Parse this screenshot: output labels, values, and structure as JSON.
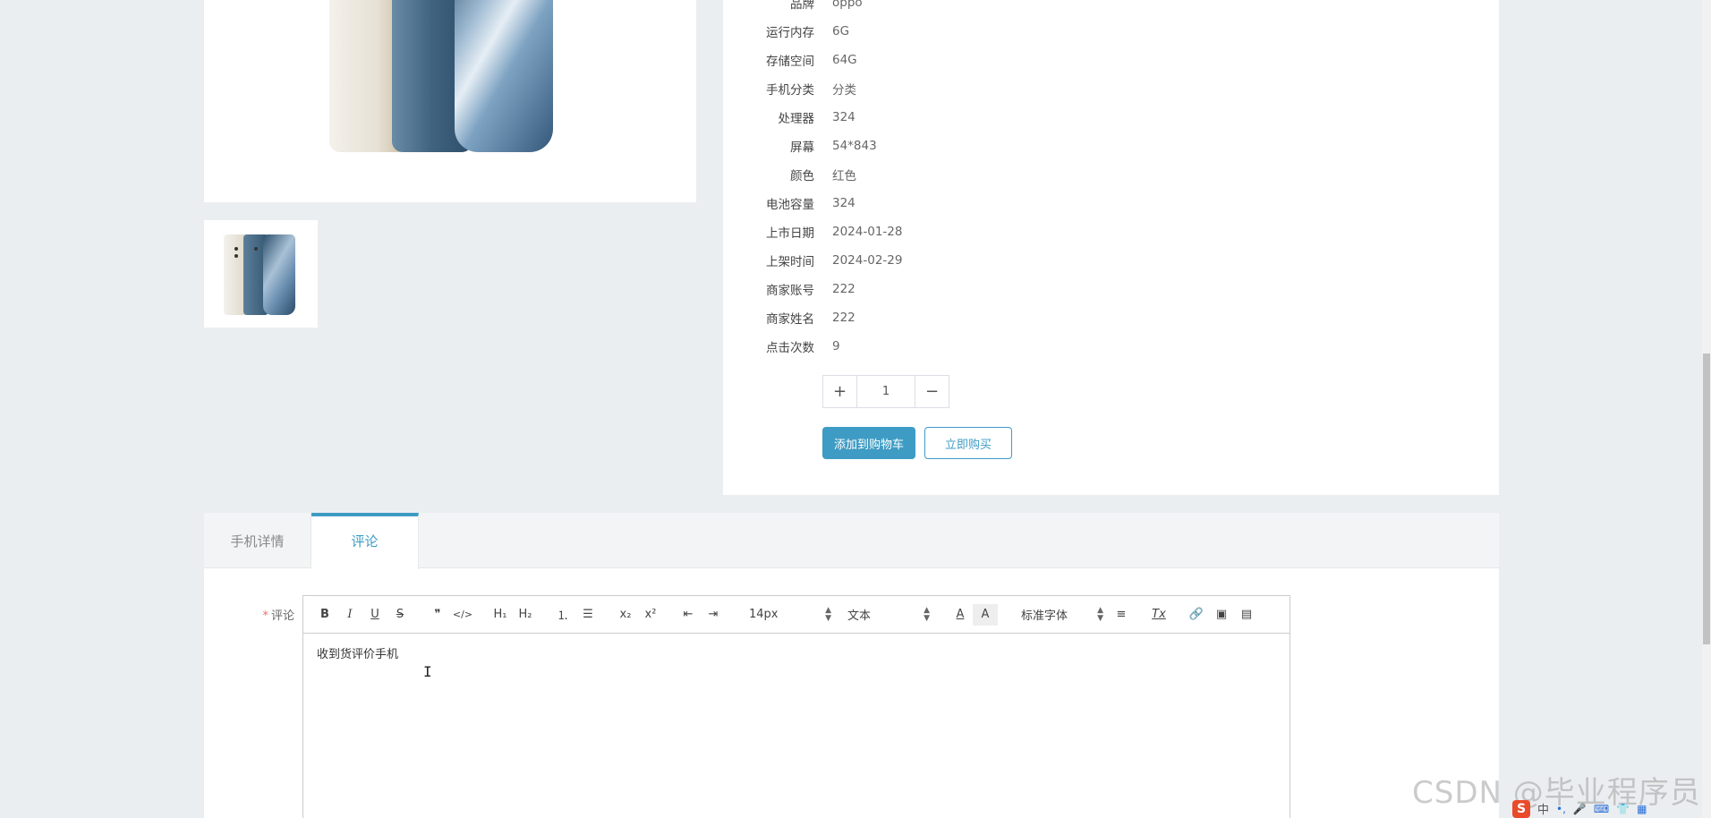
{
  "specs": [
    {
      "label": "品牌",
      "value": "oppo"
    },
    {
      "label": "运行内存",
      "value": "6G"
    },
    {
      "label": "存储空间",
      "value": "64G"
    },
    {
      "label": "手机分类",
      "value": "分类"
    },
    {
      "label": "处理器",
      "value": "324"
    },
    {
      "label": "屏幕",
      "value": "54*843"
    },
    {
      "label": "颜色",
      "value": "红色"
    },
    {
      "label": "电池容量",
      "value": "324"
    },
    {
      "label": "上市日期",
      "value": "2024-01-28"
    },
    {
      "label": "上架时间",
      "value": "2024-02-29"
    },
    {
      "label": "商家账号",
      "value": "222"
    },
    {
      "label": "商家姓名",
      "value": "222"
    },
    {
      "label": "点击次数",
      "value": "9"
    }
  ],
  "quantity": {
    "plus": "+",
    "value": "1",
    "minus": "−"
  },
  "actions": {
    "add_to_cart": "添加到购物车",
    "buy_now": "立即购买"
  },
  "tabs": [
    {
      "label": "手机详情",
      "active": false
    },
    {
      "label": "评论",
      "active": true
    }
  ],
  "comment": {
    "required_mark": "*",
    "label": "评论",
    "content": "收到货评价手机"
  },
  "toolbar": {
    "bold": "B",
    "italic": "I",
    "underline": "U",
    "strike": "S",
    "blockquote": "❞",
    "code": "</>",
    "h1": "H₁",
    "h2": "H₂",
    "ordered_list": "⒈",
    "bullet_list": "☰",
    "subscript": "x₂",
    "superscript": "x²",
    "outdent": "⇤",
    "indent": "⇥",
    "size_select": "14px",
    "header_select": "文本",
    "font_color": "A",
    "background_color": "A",
    "font_select": "标准字体",
    "align": "≡",
    "clean": "Tx",
    "link": "🔗",
    "image": "▣",
    "video": "▤"
  },
  "watermark": "CSDN @毕业程序员",
  "ime": {
    "logo": "S",
    "lang": "中"
  },
  "accent_color": "#3e9cc4"
}
